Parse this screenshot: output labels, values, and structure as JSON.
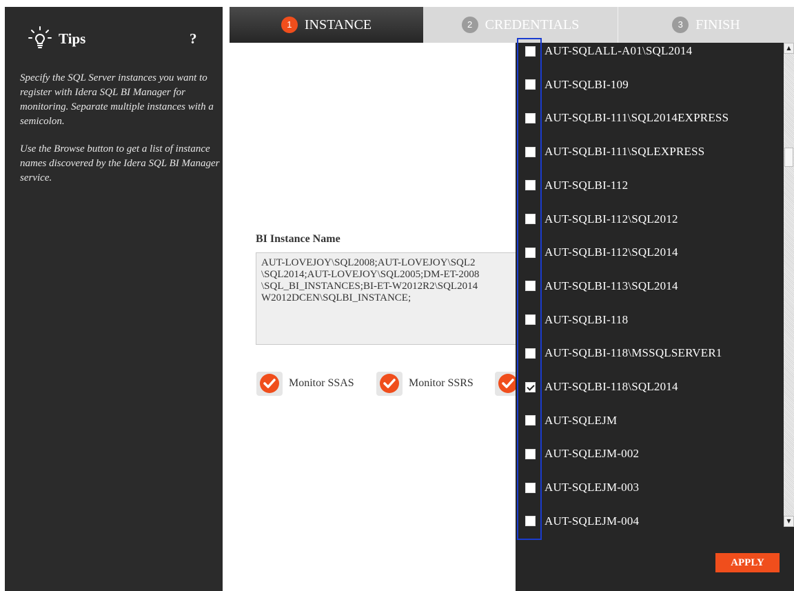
{
  "tips": {
    "title": "Tips",
    "help_label": "?",
    "paragraphs": [
      "Specify the SQL Server instances you want to register with Idera SQL BI Manager for monitoring. Separate multiple instances with a semicolon.",
      "Use the Browse button to get a list of instance names discovered by the Idera SQL BI Manager service."
    ]
  },
  "tabs": [
    {
      "number": "1",
      "label": "INSTANCE",
      "active": true
    },
    {
      "number": "2",
      "label": "CREDENTIALS",
      "active": false
    },
    {
      "number": "3",
      "label": "FINISH",
      "active": false
    }
  ],
  "form": {
    "label": "BI Instance Name",
    "value": "AUT-LOVEJOY\\SQL2008;AUT-LOVEJOY\\SQL2\n\\SQL2014;AUT-LOVEJOY\\SQL2005;DM-ET-2008\n\\SQL_BI_INSTANCES;BI-ET-W2012R2\\SQL2014\nW2012DCEN\\SQLBI_INSTANCE;"
  },
  "monitor_options": [
    {
      "label": "Monitor SSAS",
      "checked": true
    },
    {
      "label": "Monitor SSRS",
      "checked": true
    },
    {
      "label": "",
      "checked": true
    }
  ],
  "instance_list": {
    "items": [
      {
        "label": "AUT-SQLALL-A01\\SQL2014",
        "checked": false
      },
      {
        "label": "AUT-SQLBI-109",
        "checked": false
      },
      {
        "label": "AUT-SQLBI-111\\SQL2014EXPRESS",
        "checked": false
      },
      {
        "label": "AUT-SQLBI-111\\SQLEXPRESS",
        "checked": false
      },
      {
        "label": "AUT-SQLBI-112",
        "checked": false
      },
      {
        "label": "AUT-SQLBI-112\\SQL2012",
        "checked": false
      },
      {
        "label": "AUT-SQLBI-112\\SQL2014",
        "checked": false
      },
      {
        "label": "AUT-SQLBI-113\\SQL2014",
        "checked": false
      },
      {
        "label": "AUT-SQLBI-118",
        "checked": false
      },
      {
        "label": "AUT-SQLBI-118\\MSSQLSERVER1",
        "checked": false
      },
      {
        "label": "AUT-SQLBI-118\\SQL2014",
        "checked": true
      },
      {
        "label": "AUT-SQLEJM",
        "checked": false
      },
      {
        "label": "AUT-SQLEJM-002",
        "checked": false
      },
      {
        "label": "AUT-SQLEJM-003",
        "checked": false
      },
      {
        "label": "AUT-SQLEJM-004",
        "checked": false
      }
    ],
    "apply_label": "APPLY"
  },
  "colors": {
    "accent": "#f04e1c",
    "panel_dark": "#2b2b2b",
    "highlight_border": "#1a3ccf"
  },
  "icons": {
    "tips": "lightbulb-icon",
    "help": "question-mark-icon",
    "monitor_check": "check-circle-icon"
  }
}
